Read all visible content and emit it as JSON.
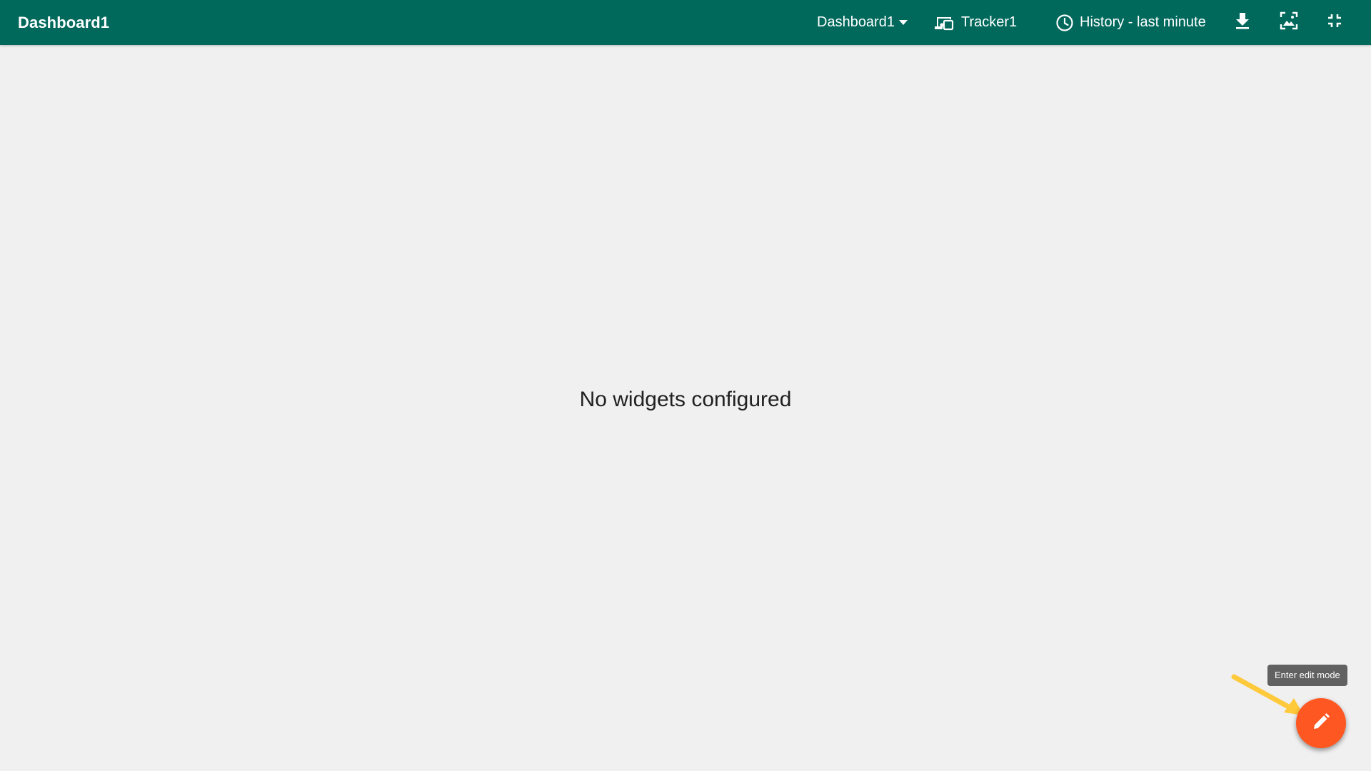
{
  "toolbar": {
    "title": "Dashboard1",
    "dashboard_select": {
      "selected": "Dashboard1",
      "icon": "caret-down-icon"
    },
    "tracker": {
      "label": "Tracker1",
      "icon": "devices-icon"
    },
    "history": {
      "label": "History - last minute",
      "icon": "clock-icon"
    },
    "actions": [
      {
        "name": "download",
        "icon": "download-icon"
      },
      {
        "name": "screenshot",
        "icon": "screenshot-icon"
      },
      {
        "name": "exit-fullscreen",
        "icon": "fullscreen-exit-icon"
      }
    ]
  },
  "main": {
    "empty_message": "No widgets configured"
  },
  "fab": {
    "tooltip": "Enter edit mode",
    "icon": "pencil-icon"
  },
  "colors": {
    "toolbar_bg": "#00695c",
    "page_bg": "#f0f0f0",
    "fab_bg": "#ff5722",
    "tooltip_bg": "#616161",
    "annotation_arrow": "#ffc93c"
  }
}
